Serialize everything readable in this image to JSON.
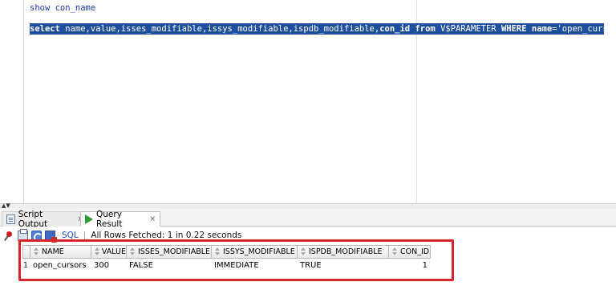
{
  "editor": {
    "line1": "show con_name",
    "line2": {
      "select_kw": "select",
      "cols_pre": " name,value,isses_modifiable,issys_modifiable,ispdb_modifiable,",
      "con_id": "con_id",
      "from_kw": " from",
      "rest": " V$PARAMETER ",
      "where_kw": "WHERE",
      "name_kw": " name",
      "cond": "='open_cursors';"
    }
  },
  "tabs": [
    {
      "label": "Script Output",
      "close": "×",
      "icon": "document-icon"
    },
    {
      "label": "Query Result",
      "close": "×",
      "icon": "run-icon"
    }
  ],
  "toolbar": {
    "sql_label": "SQL",
    "separator": "|",
    "status": "All Rows Fetched: 1 in 0.22 seconds"
  },
  "grid": {
    "columns": [
      "NAME",
      "VALUE",
      "ISSES_MODIFIABLE",
      "ISSYS_MODIFIABLE",
      "ISPDB_MODIFIABLE",
      "CON_ID"
    ],
    "rows": [
      {
        "num": "1",
        "cells": [
          "open_cursors",
          "300",
          "FALSE",
          "IMMEDIATE",
          "TRUE",
          "1"
        ]
      }
    ]
  },
  "colors": {
    "selection": "#1f4f9e",
    "highlight_box": "#d8232a",
    "link": "#1c4dbd"
  }
}
